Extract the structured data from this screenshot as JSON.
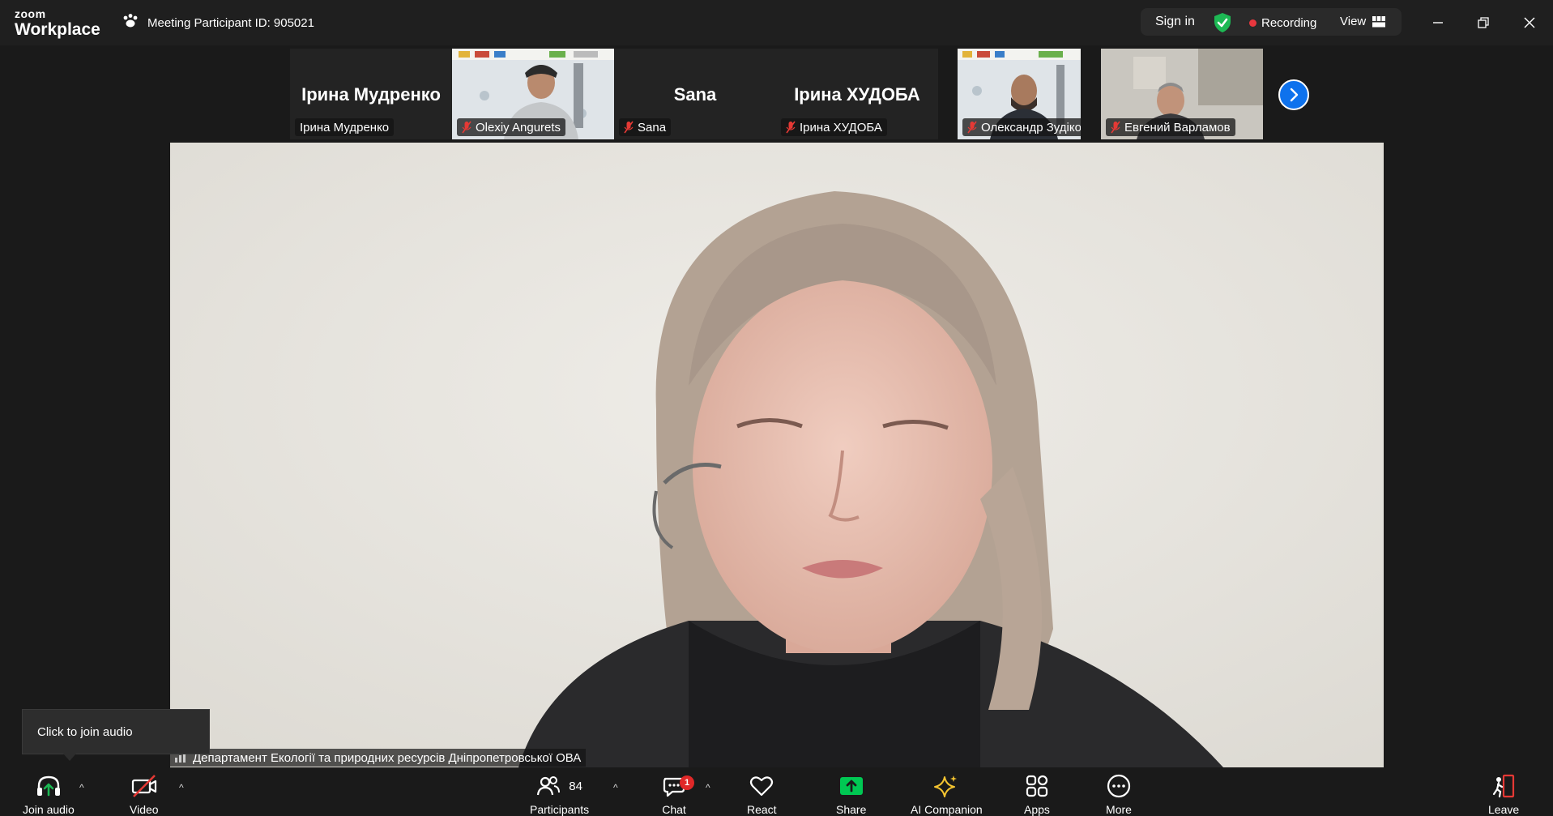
{
  "app": {
    "brand_small": "zoom",
    "brand_large": "Workplace"
  },
  "meeting": {
    "id_text": "Meeting Participant ID: 905021"
  },
  "header": {
    "signin_label": "Sign in",
    "recording_label": "Recording",
    "view_label": "View"
  },
  "thumbnails": [
    {
      "display": "Ірина Мудренко",
      "tag": "Ірина Мудренко",
      "muted": false,
      "video": false
    },
    {
      "display": "",
      "tag": "Olexiy Angurets",
      "muted": true,
      "video": true
    },
    {
      "display": "Sana",
      "tag": "Sana",
      "muted": true,
      "video": false
    },
    {
      "display": "Ірина ХУДОБА",
      "tag": "Ірина ХУДОБА",
      "muted": true,
      "video": false
    },
    {
      "display": "",
      "tag": "Олександр Зудіков",
      "muted": true,
      "video": true
    },
    {
      "display": "",
      "tag": "Евгений Варламов",
      "muted": true,
      "video": true
    }
  ],
  "main": {
    "speaker_name": "Департамент Екології та природних ресурсів Дніпропетровської ОВА"
  },
  "tooltip": {
    "text": "Click to join audio"
  },
  "toolbar": {
    "join_audio": "Join audio",
    "video": "Video",
    "participants": "Participants",
    "participants_count": "84",
    "chat": "Chat",
    "chat_badge": "1",
    "react": "React",
    "share": "Share",
    "ai_companion": "AI Companion",
    "apps": "Apps",
    "more": "More",
    "leave": "Leave"
  },
  "colors": {
    "accent": "#0e72ed",
    "share_green": "#00c853",
    "record_red": "#e8373e",
    "shield_green": "#1db954"
  }
}
